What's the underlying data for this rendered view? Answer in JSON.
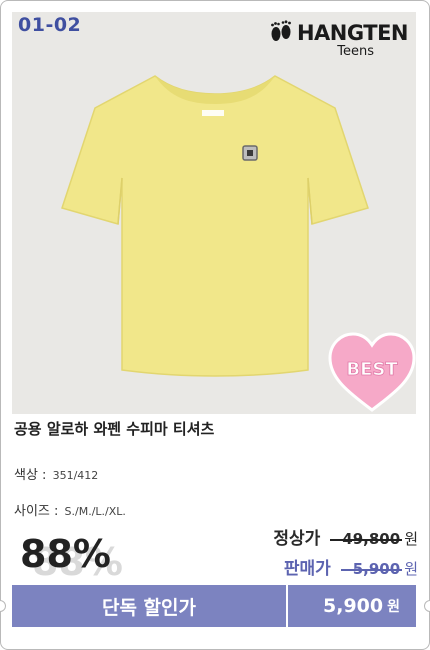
{
  "product": {
    "item_code": "01-02",
    "brand_name": "HANGTEN",
    "brand_sub": "Teens",
    "badge": "BEST",
    "title": "공용 알로하 와펜 수피마 티셔츠",
    "color_label": "색상 :",
    "color_value": "351/412",
    "size_label": "사이즈 :",
    "size_value": "S./M./L./XL.",
    "discount": "88%",
    "regular_label": "정상가",
    "regular_price": "49,800",
    "sale_label": "판매가",
    "sale_price": "5,900",
    "currency": "원",
    "promo_label": "단독 할인가",
    "promo_price": "5,900"
  },
  "colors": {
    "accent": "#7c83c0",
    "sale_text": "#5c63b0",
    "item_code": "#3f4fa0",
    "shirt": "#f1e78a",
    "badge_heart": "#f6a9c8"
  },
  "icons": {
    "brand_logo": "footprints-icon",
    "product_image": "tshirt-image"
  }
}
